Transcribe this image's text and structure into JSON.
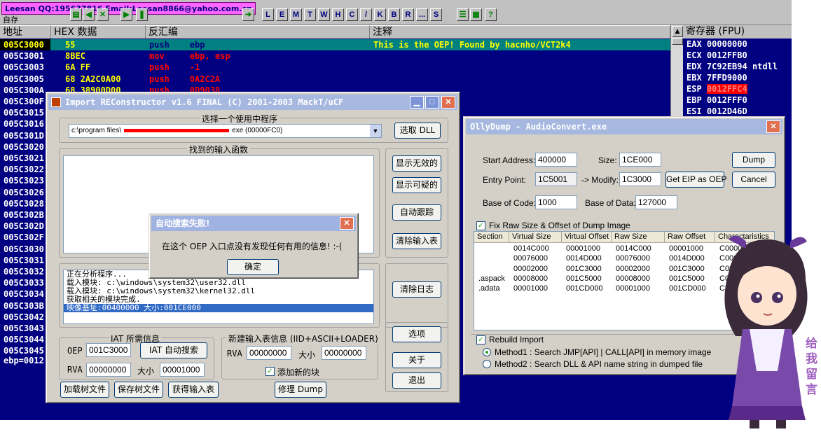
{
  "olly": {
    "credit_banner": "Leesan QQ:195637816 Email:Leesan8866@yahoo.com.cn",
    "menu_fragment": "自存",
    "toolbar_letters": [
      "L",
      "E",
      "M",
      "T",
      "W",
      "H",
      "C",
      "/",
      "K",
      "B",
      "R",
      "...",
      "S"
    ],
    "columns": {
      "address": "地址",
      "hex": "HEX 数据",
      "disasm": "反汇编",
      "comment": "注释"
    },
    "rows": [
      {
        "addr": "005C3000",
        "hex": "55",
        "asm": "push    ebp",
        "comment": "This is the OEP! Found by hacnho/VCT2k4"
      },
      {
        "addr": "005C3001",
        "hex": "8BEC",
        "asm": "mov     ebp, esp",
        "comment": ""
      },
      {
        "addr": "005C3003",
        "hex": "6A FF",
        "asm": "push    -1",
        "comment": ""
      },
      {
        "addr": "005C3005",
        "hex": "68 2A2C0A00",
        "asm": "push    0A2C2A",
        "comment": ""
      },
      {
        "addr": "005C300A",
        "hex": "68 38900D00",
        "asm": "push    0D9038",
        "comment": ""
      },
      {
        "addr": "005C300F",
        "hex": "",
        "asm": "",
        "comment": ""
      },
      {
        "addr": "005C3015",
        "hex": "",
        "asm": "",
        "comment": ""
      },
      {
        "addr": "005C3016",
        "hex": "",
        "asm": "",
        "comment": ""
      },
      {
        "addr": "005C301D",
        "hex": "",
        "asm": "",
        "comment": ""
      },
      {
        "addr": "005C3020",
        "hex": "",
        "asm": "",
        "comment": ""
      },
      {
        "addr": "005C3021",
        "hex": "",
        "asm": "",
        "comment": ""
      },
      {
        "addr": "005C3022",
        "hex": "",
        "asm": "",
        "comment": ""
      },
      {
        "addr": "005C3023",
        "hex": "",
        "asm": "",
        "comment": ""
      },
      {
        "addr": "005C3026",
        "hex": "",
        "asm": "",
        "comment": ""
      },
      {
        "addr": "005C3028",
        "hex": "",
        "asm": "",
        "comment": ""
      },
      {
        "addr": "005C302B",
        "hex": "",
        "asm": "",
        "comment": ""
      },
      {
        "addr": "005C302D",
        "hex": "",
        "asm": "",
        "comment": ""
      },
      {
        "addr": "005C302F",
        "hex": "",
        "asm": "",
        "comment": ""
      },
      {
        "addr": "005C3030",
        "hex": "",
        "asm": "",
        "comment": ""
      },
      {
        "addr": "005C3031",
        "hex": "",
        "asm": "",
        "comment": ""
      },
      {
        "addr": "005C3032",
        "hex": "",
        "asm": "",
        "comment": ""
      },
      {
        "addr": "005C3033",
        "hex": "",
        "asm": "",
        "comment": ""
      },
      {
        "addr": "005C3034",
        "hex": "",
        "asm": "",
        "comment": ""
      },
      {
        "addr": "005C303B",
        "hex": "",
        "asm": "",
        "comment": ""
      },
      {
        "addr": "005C3042",
        "hex": "",
        "asm": "",
        "comment": ""
      },
      {
        "addr": "005C3043",
        "hex": "",
        "asm": "",
        "comment": ""
      },
      {
        "addr": "005C3044",
        "hex": "",
        "asm": "",
        "comment": ""
      },
      {
        "addr": "005C3045",
        "hex": "",
        "asm": "",
        "comment": ""
      }
    ],
    "registers_title": "寄存器 (FPU)",
    "registers": [
      {
        "name": "EAX",
        "value": "00000000"
      },
      {
        "name": "ECX",
        "value": "0012FFB0"
      },
      {
        "name": "EDX",
        "value": "7C92EB94 ntdll"
      },
      {
        "name": "EBX",
        "value": "7FFD9000"
      },
      {
        "name": "ESP",
        "value": "0012FFC4"
      },
      {
        "name": "EBP",
        "value": "0012FFF0"
      },
      {
        "name": "ESI",
        "value": "0012D46D"
      }
    ],
    "status_expr": "ebp=0012"
  },
  "importrec": {
    "title": "Import REConstructor v1.6 FINAL (C) 2001-2003 MackT/uCF",
    "process_group": "选择一个使用中程序",
    "process_path": "c:\\program files\\",
    "process_suffix": "exe (00000FC0)",
    "pick_dll_button": "选取 DLL",
    "imports_group": "找到的输入函数",
    "show_invalid_button": "显示无效的",
    "show_suspect_button": "显示可疑的",
    "auto_trace_button": "自动跟踪",
    "clear_imports_button": "清除输入表",
    "log_lines": [
      "正在分析程序...",
      "载入模块: c:\\windows\\system32\\user32.dll",
      "载入模块: c:\\windows\\system32\\kernel32.dll",
      "获取相关的模块完成.",
      "映像基址:00400000 大小:001CE000"
    ],
    "clear_log_button": "清除日志",
    "iat_group": "IAT 所需信息",
    "oep_label": "OEP",
    "oep_value": "001C3000",
    "iat_autosearch_button": "IAT 自动搜索",
    "rva_label": "RVA",
    "rva_value": "00000000",
    "size_label": "大小",
    "size_value": "00001000",
    "newiat_group": "新建输入表信息 (IID+ASCII+LOADER)",
    "new_rva_label": "RVA",
    "new_rva_value": "00000000",
    "new_size_label": "大小",
    "new_size_value": "00000000",
    "add_section_label": "添加新的块",
    "options_button": "选项",
    "about_button": "关于",
    "exit_button": "退出",
    "load_tree_button": "加载树文件",
    "save_tree_button": "保存树文件",
    "get_imports_button": "获得输入表",
    "fix_dump_button": "修理 Dump"
  },
  "alert": {
    "title": "自动搜索失败!",
    "message": "在这个 OEP 入口点没有发现任何有用的信息!  :-(",
    "ok_button": "确定"
  },
  "ollydump": {
    "title": "OllyDump - AudioConvert.exe",
    "start_address_label": "Start Address:",
    "start_address": "400000",
    "size_label": "Size:",
    "size": "1CE000",
    "dump_button": "Dump",
    "entry_point_label": "Entry Point:",
    "entry_point": "1C5001",
    "modify_label": "-> Modify:",
    "modify": "1C3000",
    "get_eip_button": "Get EIP as OEP",
    "cancel_button": "Cancel",
    "base_code_label": "Base of Code:",
    "base_code": "1000",
    "base_data_label": "Base of Data:",
    "base_data": "127000",
    "fix_raw_label": "Fix Raw Size & Offset of Dump Image",
    "table_headers": [
      "Section",
      "Virtual Size",
      "Virtual Offset",
      "Raw Size",
      "Raw Offset",
      "Charactaristics"
    ],
    "table_rows": [
      [
        "",
        "0014C000",
        "00001000",
        "0014C000",
        "00001000",
        "C0000040"
      ],
      [
        "",
        "00076000",
        "0014D000",
        "00076000",
        "0014D000",
        "C0000040"
      ],
      [
        "",
        "00002000",
        "001C3000",
        "00002000",
        "001C3000",
        "C0000040"
      ],
      [
        ".aspack",
        "00008000",
        "001C5000",
        "00008000",
        "001C5000",
        "C0000040"
      ],
      [
        ".adata",
        "00001000",
        "001CD000",
        "00001000",
        "001CD000",
        "C0000040"
      ]
    ],
    "rebuild_label": "Rebuild Import",
    "method1": "Method1 : Search JMP[API] | CALL[API] in memory image",
    "method2": "Method2 : Search DLL & API name string in dumped file"
  },
  "decor": {
    "vertical_text": "给我留言"
  }
}
